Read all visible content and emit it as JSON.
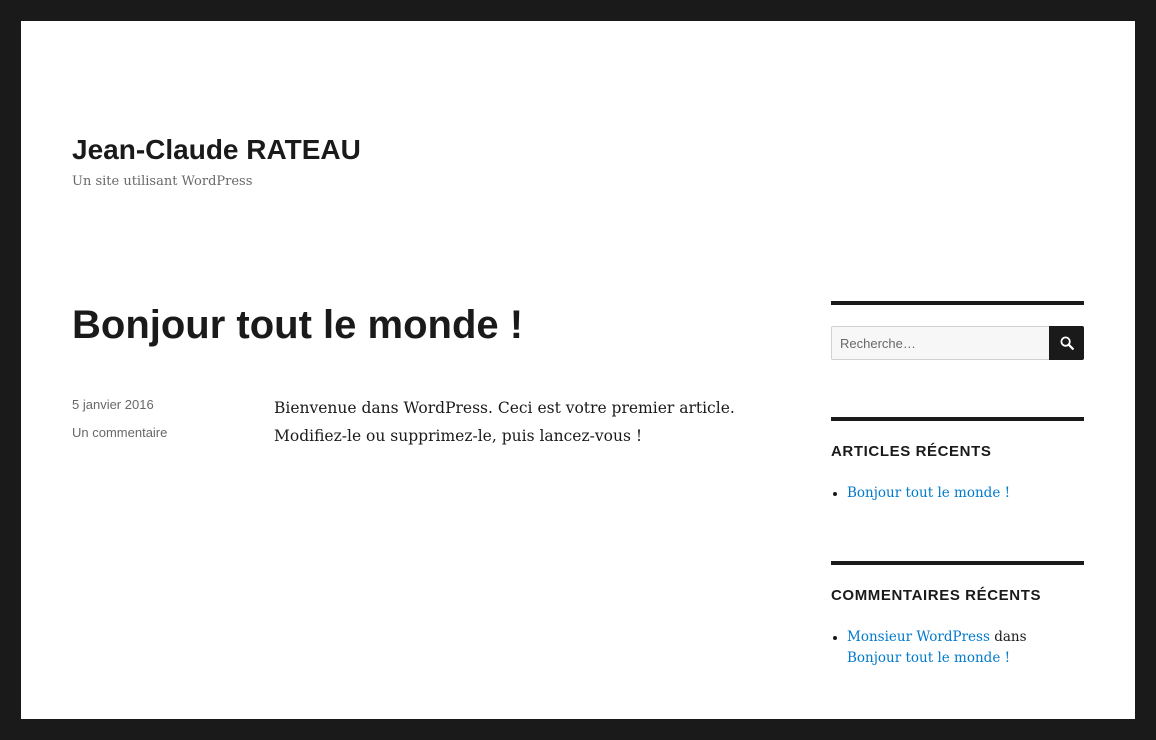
{
  "header": {
    "site_title": "Jean-Claude RATEAU",
    "site_description": "Un site utilisant WordPress"
  },
  "post": {
    "title": "Bonjour tout le monde !",
    "date": "5 janvier 2016",
    "comments_link": "Un commentaire",
    "content_line1": "Bienvenue dans WordPress. Ceci est votre premier article.",
    "content_line2": "Modifiez-le ou supprimez-le, puis lancez-vous !"
  },
  "sidebar": {
    "search": {
      "placeholder": "Recherche…",
      "value": "",
      "button_icon": "search-icon"
    },
    "recent_posts": {
      "title": "ARTICLES RÉCENTS",
      "items": [
        {
          "label": "Bonjour tout le monde !"
        }
      ]
    },
    "recent_comments": {
      "title": "COMMENTAIRES RÉCENTS",
      "items": [
        {
          "author": "Monsieur WordPress",
          "connector": "dans",
          "post": "Bonjour tout le monde !"
        }
      ]
    }
  },
  "colors": {
    "frame": "#1a1a1a",
    "background": "#ffffff",
    "text": "#1a1a1a",
    "secondary_text": "#686868",
    "link": "#007acc"
  }
}
